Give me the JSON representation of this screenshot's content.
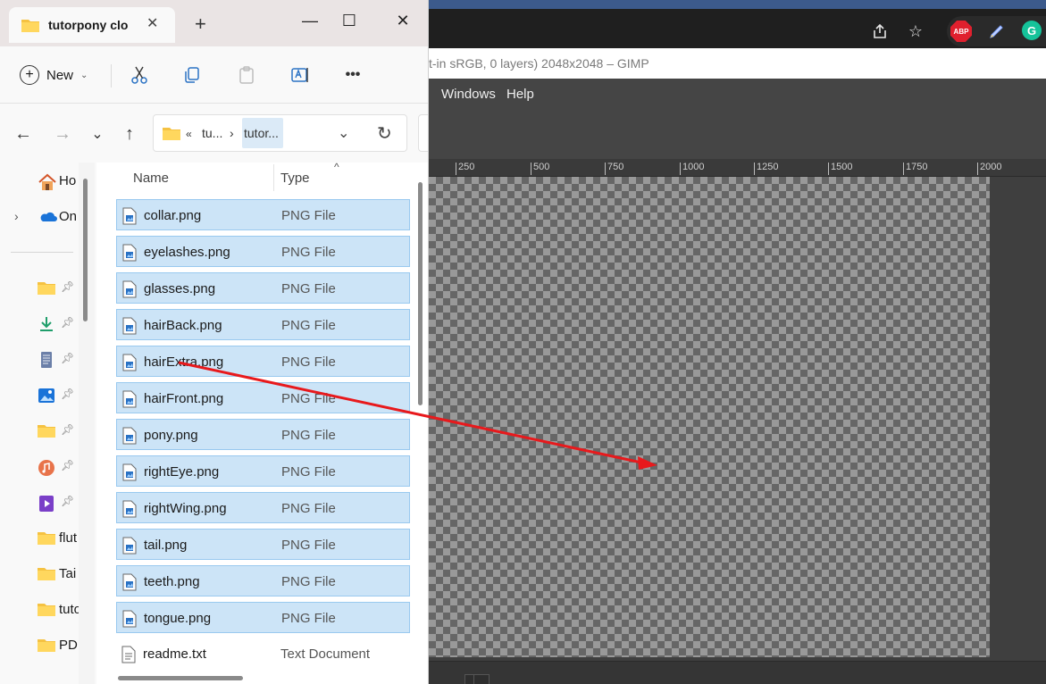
{
  "browser": {
    "extensions": [
      {
        "name": "adblock-plus",
        "label": "ABP"
      },
      {
        "name": "pen-tool",
        "label": ""
      },
      {
        "name": "grammarly",
        "label": "G"
      }
    ]
  },
  "gimp": {
    "title": "t-in sRGB, 0 layers) 2048x2048 – GIMP",
    "menu": [
      "Windows",
      "Help"
    ],
    "ruler_ticks": [
      "250",
      "500",
      "750",
      "1000",
      "1250",
      "1500",
      "1750",
      "2000"
    ]
  },
  "explorer": {
    "tab_title": "tutorpony clo",
    "tab_close": "✕",
    "new_tab": "+",
    "window_controls": {
      "minimize": "—",
      "maximize": "☐",
      "close": "✕"
    },
    "toolbar": {
      "new_label": "New",
      "more_label": "•••"
    },
    "address": {
      "prefix": "«",
      "crumb1": "tu...",
      "sep": "›",
      "crumb2": "tutor..."
    },
    "nav_pane": {
      "home_label": "Ho",
      "onedrive_label": "On",
      "folders": [
        "flut",
        "Tai",
        "tuto",
        "PD"
      ]
    },
    "columns": {
      "name": "Name",
      "type": "Type",
      "sort_indicator": "^"
    },
    "files": [
      {
        "name": "collar.png",
        "type": "PNG File",
        "selected": true
      },
      {
        "name": "eyelashes.png",
        "type": "PNG File",
        "selected": true
      },
      {
        "name": "glasses.png",
        "type": "PNG File",
        "selected": true
      },
      {
        "name": "hairBack.png",
        "type": "PNG File",
        "selected": true
      },
      {
        "name": "hairExtra.png",
        "type": "PNG File",
        "selected": true
      },
      {
        "name": "hairFront.png",
        "type": "PNG File",
        "selected": true
      },
      {
        "name": "pony.png",
        "type": "PNG File",
        "selected": true
      },
      {
        "name": "rightEye.png",
        "type": "PNG File",
        "selected": true
      },
      {
        "name": "rightWing.png",
        "type": "PNG File",
        "selected": true
      },
      {
        "name": "tail.png",
        "type": "PNG File",
        "selected": true
      },
      {
        "name": "teeth.png",
        "type": "PNG File",
        "selected": true
      },
      {
        "name": "tongue.png",
        "type": "PNG File",
        "selected": true
      },
      {
        "name": "readme.txt",
        "type": "Text Document",
        "selected": false
      }
    ]
  },
  "colors": {
    "selection": "#cce4f7",
    "selection_border": "#99c9ef",
    "drag_arrow": "#e8191c",
    "gimp_menu": "#454545",
    "folder": "#f5c242"
  }
}
